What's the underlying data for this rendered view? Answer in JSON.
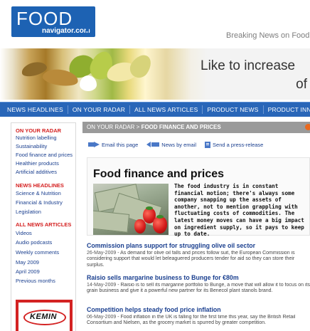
{
  "header": {
    "logo_main": "FOOD",
    "logo_sub": "navigator.com",
    "tagline": "Breaking News on Food"
  },
  "banner": {
    "line1": "Like to increase",
    "line2": "of"
  },
  "nav": {
    "items": [
      "NEWS HEADLINES",
      "ON YOUR RADAR",
      "ALL NEWS ARTICLES",
      "PRODUCT NEWS",
      "PRODUCT INNOVATIONS"
    ]
  },
  "sidebar": {
    "sections": [
      {
        "title": "ON YOUR RADAR",
        "links": [
          "Nutrition labelling",
          "Sustainability",
          "Food finance and prices",
          "Healthier products",
          "Artificial additives"
        ]
      },
      {
        "title": "NEWS HEADLINES",
        "links": [
          "Science & Nutrition",
          "Financial & Industry",
          "Legislation"
        ]
      },
      {
        "title": "ALL NEWS ARTICLES",
        "links": [
          "Videos",
          "Audio podcasts",
          "Weekly comments",
          "May 2009",
          "April 2009",
          "Previous months"
        ]
      }
    ],
    "ad": {
      "brand": "KEMIN"
    }
  },
  "breadcrumb": {
    "parent": "ON YOUR RADAR",
    "separator": ">",
    "current": "FOOD FINANCE AND PRICES"
  },
  "tools": {
    "email": "Email this page",
    "news_by_email": "News by email",
    "press_release": "Send a press-release"
  },
  "article": {
    "title": "Food finance and prices",
    "intro": "The food industry is in constant financial motion; there's always some company snapping up the assets of another, not to mention grappling with fluctuating costs of commodities. The latest money moves can have a big impact on ingredient supply, so it pays to keep up to date."
  },
  "news": [
    {
      "title": "Commission plans support for struggling olive oil sector",
      "date": "26-May-2009",
      "body": " - As demand for olive oil falls and prices follow suit, the European Commission is considering support that would let beleaguered producers tender for aid so they can store their surplus."
    },
    {
      "title": "Raisio sells margarine business to Bunge for €80m",
      "date": "14-May-2009",
      "body": " - Raisio is to sell its margarine portfolio to Bunge, a move that will allow it to focus on its grain business and give it a powerful new partner for its Benecol plant stanols brand."
    },
    {
      "title": "Competition helps steady food price inflation",
      "date": "06-May-2009",
      "body": " - Food inflation in the UK is falling for the first time this year, say the British Retail Consortium and Nielsen, as the grocery market is spurred by greater competition."
    }
  ],
  "colors": {
    "brand_blue": "#1d62b3",
    "nav_blue": "#2966b8",
    "section_red": "#d42020",
    "link_blue": "#1a3f8f",
    "breadcrumb_gray": "#9a9a9a",
    "accent_orange": "#e9691f"
  }
}
